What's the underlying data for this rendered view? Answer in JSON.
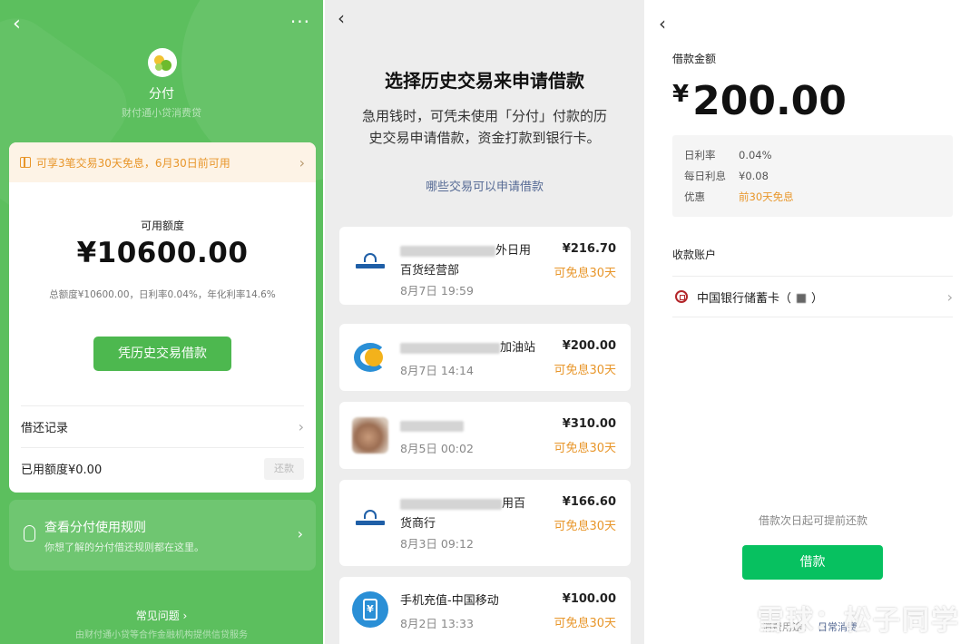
{
  "panel1": {
    "back_icon": "chevron-left-icon",
    "more_icon": "more-icon",
    "brand_name": "分付",
    "brand_sub": "财付通小贷消费贷",
    "promo_text": "可享3笔交易30天免息，6月30日前可用",
    "credit_label": "可用额度",
    "credit_amount": "¥10600.00",
    "credit_detail": "总额度¥10600.00，日利率0.04%，年化利率14.6%",
    "borrow_button": "凭历史交易借款",
    "records_label": "借还记录",
    "used_label": "已用额度¥0.00",
    "repay_button": "还款",
    "rules_title": "查看分付使用规则",
    "rules_sub": "你想了解的分付借还规则都在这里。",
    "faq": "常见问题 ›",
    "footer": "由财付通小贷等合作金融机构提供信贷服务",
    "colors": {
      "bg": "#5cbf5e",
      "button": "#4db84f",
      "accent": "#e8962a"
    }
  },
  "panel2": {
    "title": "选择历史交易来申请借款",
    "description": "急用钱时，可凭未使用「分付」付款的历史交易申请借款，资金打款到银行卡。",
    "link": "哪些交易可以申请借款",
    "transactions": [
      {
        "name_tail": "外日用",
        "name_line2": "百货经营部",
        "date": "8月7日 19:59",
        "amount": "¥216.70",
        "note": "可免息30天",
        "icon": "bank-logo-icon"
      },
      {
        "name_tail": "加油站",
        "name_line2": "",
        "date": "8月7日 14:14",
        "amount": "¥200.00",
        "note": "可免息30天",
        "icon": "gas-station-logo-icon"
      },
      {
        "name_tail": "",
        "name_line2": "",
        "date": "8月5日 00:02",
        "amount": "¥310.00",
        "note": "可免息30天",
        "icon": "avatar-photo-icon"
      },
      {
        "name_tail": "用百",
        "name_line2": "货商行",
        "date": "8月3日 09:12",
        "amount": "¥166.60",
        "note": "可免息30天",
        "icon": "bank-logo-icon"
      },
      {
        "name_tail": "手机充值-中国移动",
        "name_line2": "",
        "date": "8月2日 13:33",
        "amount": "¥100.00",
        "note": "可免息30天",
        "icon": "mobile-topup-icon"
      }
    ]
  },
  "panel3": {
    "back_icon": "chevron-left-icon",
    "amount_label": "借款金额",
    "amount_yen": "¥",
    "amount": "200.00",
    "rates": [
      {
        "k": "日利率",
        "v": "0.04%",
        "orange": false
      },
      {
        "k": "每日利息",
        "v": "¥0.08",
        "orange": false
      },
      {
        "k": "优惠",
        "v": "前30天免息",
        "orange": true
      }
    ],
    "account_label": "收款账户",
    "account_name": "中国银行储蓄卡（",
    "account_tail": "）",
    "note": "借款次日起可提前还款",
    "button": "借款",
    "usage_label": "消费用途：",
    "usage_value": "日常消费",
    "colors": {
      "button": "#07c160",
      "link": "#576b95"
    }
  },
  "watermark": "雪球：松子同学"
}
